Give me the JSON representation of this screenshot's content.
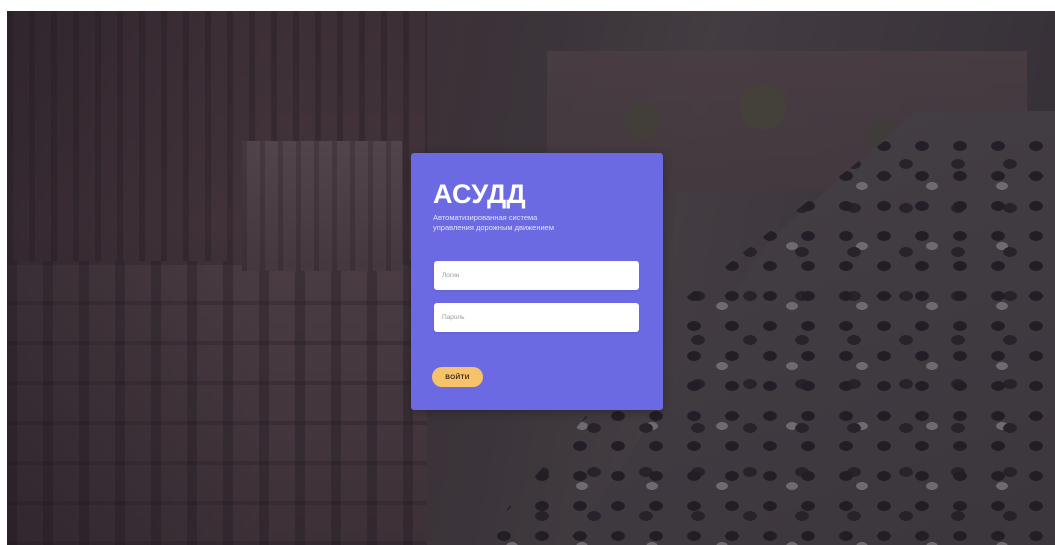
{
  "login_card": {
    "title": "АСУДД",
    "subtitle": "Автоматизированная система управления дорожным движением",
    "login_placeholder": "Логин",
    "login_value": "",
    "password_placeholder": "Пароль",
    "password_value": "",
    "submit_label": "ВОЙТИ"
  },
  "colors": {
    "card_background": "#6b6ae3",
    "submit_button": "#f7c36a",
    "input_background": "#ffffff",
    "title_text": "#ffffff"
  }
}
